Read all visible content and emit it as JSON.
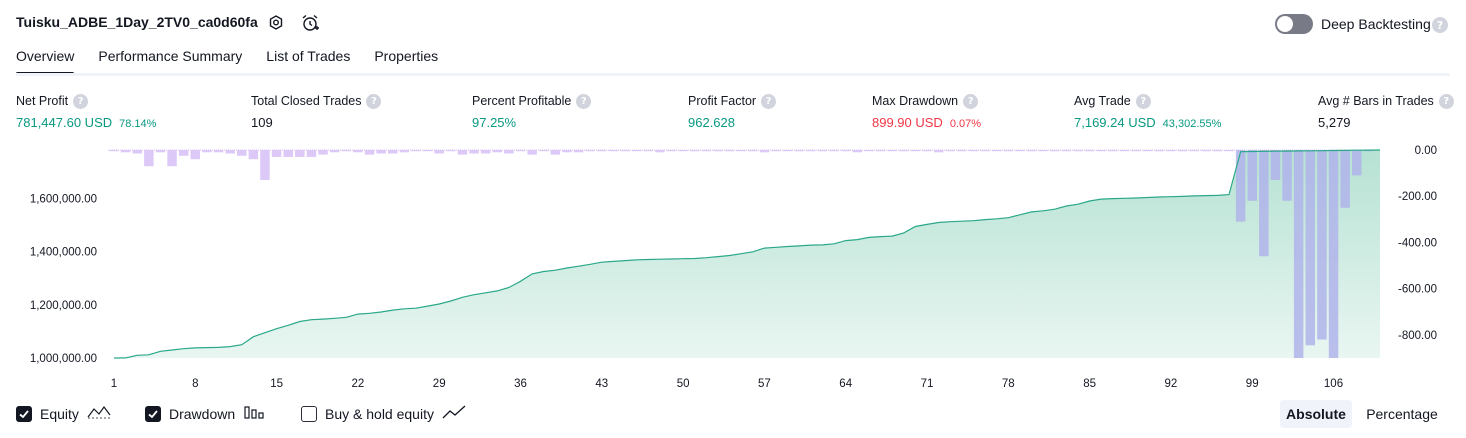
{
  "header": {
    "strategy_name": "Tuisku_ADBE_1Day_2TV0_ca0d60fa",
    "deep_backtesting_label": "Deep Backtesting",
    "deep_backtesting_on": false,
    "help_glyph": "?"
  },
  "tabs": [
    {
      "label": "Overview",
      "active": true
    },
    {
      "label": "Performance Summary",
      "active": false
    },
    {
      "label": "List of Trades",
      "active": false
    },
    {
      "label": "Properties",
      "active": false
    }
  ],
  "stats": [
    {
      "label": "Net Profit",
      "value": "781,447.60 USD",
      "pct": "78.14%",
      "tone": "green"
    },
    {
      "label": "Total Closed Trades",
      "value": "109",
      "pct": "",
      "tone": "dark"
    },
    {
      "label": "Percent Profitable",
      "value": "97.25%",
      "pct": "",
      "tone": "green"
    },
    {
      "label": "Profit Factor",
      "value": "962.628",
      "pct": "",
      "tone": "green"
    },
    {
      "label": "Max Drawdown",
      "value": "899.90 USD",
      "pct": "0.07%",
      "tone": "red"
    },
    {
      "label": "Avg Trade",
      "value": "7,169.24 USD",
      "pct": "43,302.55%",
      "tone": "green"
    },
    {
      "label": "Avg # Bars in Trades",
      "value": "5,279",
      "pct": "",
      "tone": "dark"
    }
  ],
  "colors": {
    "equity_line": "#2aa889",
    "equity_fill_top": "#b6e2d3",
    "equity_fill_bottom": "#e9f6f1",
    "drawdown_pre": "#d6bff7",
    "drawdown_post": "#b0b4ea",
    "axis_text": "#131722",
    "profit_green": "#089981",
    "loss_red": "#f23645"
  },
  "legend": [
    {
      "label": "Equity",
      "checked": true,
      "icon": "equity-line-icon"
    },
    {
      "label": "Drawdown",
      "checked": true,
      "icon": "drawdown-bars-icon"
    },
    {
      "label": "Buy & hold equity",
      "checked": false,
      "icon": "buy-hold-line-icon"
    }
  ],
  "mode_toggle": {
    "absolute": "Absolute",
    "percentage": "Percentage",
    "selected": "absolute"
  },
  "chart_data": {
    "type": "line",
    "title": "",
    "xlabel": "",
    "x_ticks": [
      1,
      8,
      15,
      22,
      29,
      36,
      43,
      50,
      57,
      64,
      71,
      78,
      85,
      92,
      99,
      106
    ],
    "x_range": [
      1,
      110
    ],
    "left_axis": {
      "ticks": [
        1000000,
        1200000,
        1400000,
        1600000
      ],
      "tick_labels": [
        "1,000,000.00",
        "1,200,000.00",
        "1,400,000.00",
        "1,600,000.00"
      ],
      "range": [
        1000000,
        1781448
      ]
    },
    "right_axis": {
      "ticks": [
        0,
        -200,
        -400,
        -600,
        -800
      ],
      "tick_labels": [
        "0.00",
        "-200.00",
        "-400.00",
        "-600.00",
        "-800.00"
      ],
      "range": [
        -900,
        0
      ]
    },
    "series": [
      {
        "name": "Equity",
        "kind": "area",
        "axis": "left",
        "values": [
          1000000,
          1000300,
          1010000,
          1012000,
          1025000,
          1030000,
          1035000,
          1038000,
          1039000,
          1040000,
          1043000,
          1050000,
          1080000,
          1095000,
          1110000,
          1123000,
          1137000,
          1144000,
          1146000,
          1149000,
          1153000,
          1165000,
          1168000,
          1173000,
          1180000,
          1185000,
          1187000,
          1195000,
          1203000,
          1214000,
          1228000,
          1238000,
          1245000,
          1252000,
          1265000,
          1288000,
          1316000,
          1325000,
          1330000,
          1338000,
          1345000,
          1352000,
          1360000,
          1363000,
          1366000,
          1369000,
          1370000,
          1371000,
          1372000,
          1373000,
          1374000,
          1377000,
          1381000,
          1385000,
          1392000,
          1399000,
          1413000,
          1416000,
          1419000,
          1421000,
          1424000,
          1425000,
          1429000,
          1441000,
          1445000,
          1453000,
          1456000,
          1458000,
          1470000,
          1494000,
          1502000,
          1509000,
          1512000,
          1514000,
          1516000,
          1520000,
          1523000,
          1527000,
          1538000,
          1549000,
          1553000,
          1559000,
          1571000,
          1578000,
          1590000,
          1597000,
          1599000,
          1600000,
          1601000,
          1603000,
          1605000,
          1606000,
          1607000,
          1609000,
          1610000,
          1611000,
          1614000,
          1775000,
          1776000,
          1776500,
          1777000,
          1777500,
          1778000,
          1778500,
          1779000,
          1779500,
          1780000,
          1780800,
          1781000,
          1781448
        ]
      },
      {
        "name": "Drawdown",
        "kind": "bar",
        "axis": "right",
        "values": [
          -5,
          -10,
          -15,
          -70,
          -10,
          -70,
          -25,
          -40,
          -10,
          -10,
          -15,
          -25,
          -40,
          -130,
          -30,
          -30,
          -30,
          -30,
          -20,
          -10,
          -5,
          -10,
          -20,
          -15,
          -15,
          -10,
          -5,
          -5,
          -15,
          -5,
          -20,
          -15,
          -15,
          -10,
          -15,
          -5,
          -20,
          -5,
          -20,
          -10,
          -10,
          -5,
          -5,
          -5,
          -5,
          -5,
          -5,
          -10,
          -5,
          -5,
          -5,
          -5,
          -5,
          -5,
          -5,
          -5,
          -10,
          -5,
          -5,
          -5,
          -5,
          -5,
          -5,
          -5,
          -10,
          -5,
          -5,
          -5,
          -5,
          -5,
          -5,
          -10,
          -5,
          -5,
          -5,
          -5,
          -5,
          -5,
          -5,
          -5,
          -5,
          -5,
          -5,
          -5,
          -5,
          -5,
          -5,
          -5,
          -5,
          -5,
          -5,
          -5,
          -5,
          -5,
          -5,
          -5,
          -5,
          -310,
          -220,
          -460,
          -130,
          -220,
          -900,
          -845,
          -820,
          -900,
          -250,
          -110,
          -5
        ]
      }
    ],
    "grid": false,
    "legend_position": "bottom-left"
  }
}
